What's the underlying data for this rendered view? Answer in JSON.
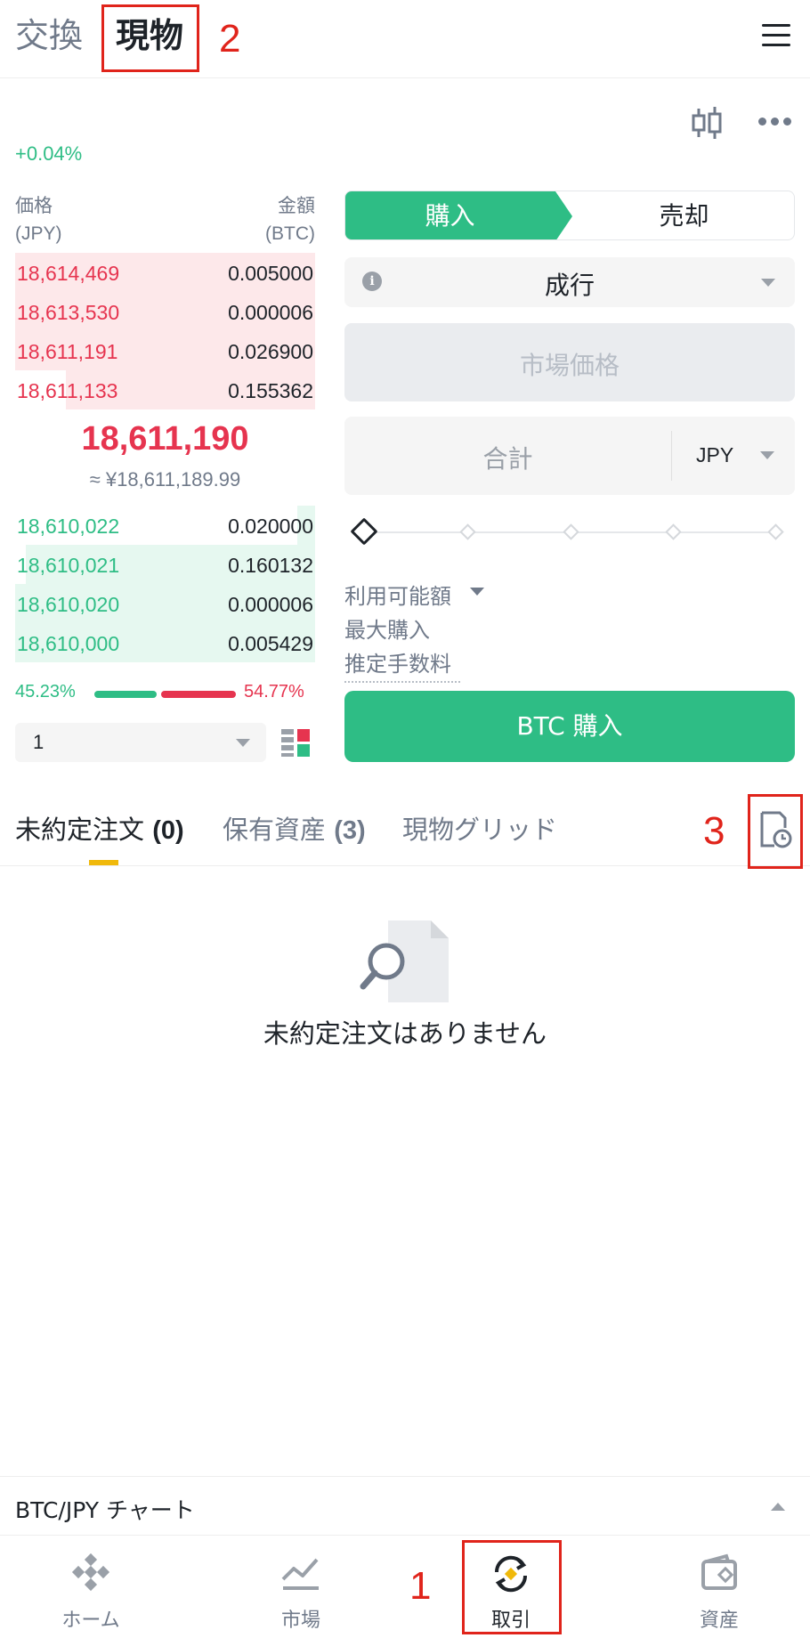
{
  "header": {
    "tabs": [
      "交換",
      "現物"
    ],
    "active_tab": "現物",
    "menu_icon": "hamburger-menu-icon"
  },
  "annotations": [
    "1",
    "2",
    "3"
  ],
  "ticker": {
    "change": "+0.04%"
  },
  "order_book": {
    "price_header": "価格",
    "price_unit": "(JPY)",
    "amount_header": "金額",
    "amount_unit": "(BTC)",
    "asks": [
      {
        "price": "18,614,469",
        "amount": "0.005000"
      },
      {
        "price": "18,613,530",
        "amount": "0.000006"
      },
      {
        "price": "18,611,191",
        "amount": "0.026900"
      },
      {
        "price": "18,611,133",
        "amount": "0.155362"
      }
    ],
    "mid_price": "18,611,190",
    "mid_price_fiat": "≈ ¥18,611,189.99",
    "bids": [
      {
        "price": "18,610,022",
        "amount": "0.020000"
      },
      {
        "price": "18,610,021",
        "amount": "0.160132"
      },
      {
        "price": "18,610,020",
        "amount": "0.000006"
      },
      {
        "price": "18,610,000",
        "amount": "0.005429"
      }
    ],
    "buy_ratio": "45.23%",
    "sell_ratio": "54.77%",
    "depth": "1"
  },
  "order_form": {
    "buy_label": "購入",
    "sell_label": "売却",
    "order_type": "成行",
    "market_price_label": "市場価格",
    "total_placeholder": "合計",
    "currency": "JPY",
    "available_label": "利用可能額",
    "max_buy_label": "最大購入",
    "est_fee_label": "推定手数料",
    "submit_label": "BTC 購入"
  },
  "orders": {
    "tabs": [
      {
        "label": "未約定注文",
        "count": "(0)"
      },
      {
        "label": "保有資産",
        "count": "(3)"
      },
      {
        "label": "現物グリッド",
        "count": ""
      }
    ],
    "empty_message": "未約定注文はありません"
  },
  "chart_bar": {
    "label": "BTC/JPY チャート"
  },
  "bottom_nav": [
    {
      "label": "ホーム",
      "icon": "home-icon"
    },
    {
      "label": "市場",
      "icon": "market-icon"
    },
    {
      "label": "取引",
      "icon": "trade-icon"
    },
    {
      "label": "資産",
      "icon": "wallet-icon"
    }
  ],
  "colors": {
    "green": "#2ebd85",
    "red": "#e6344f",
    "yellow": "#f0b90b",
    "annotation_red": "#e0241b"
  }
}
